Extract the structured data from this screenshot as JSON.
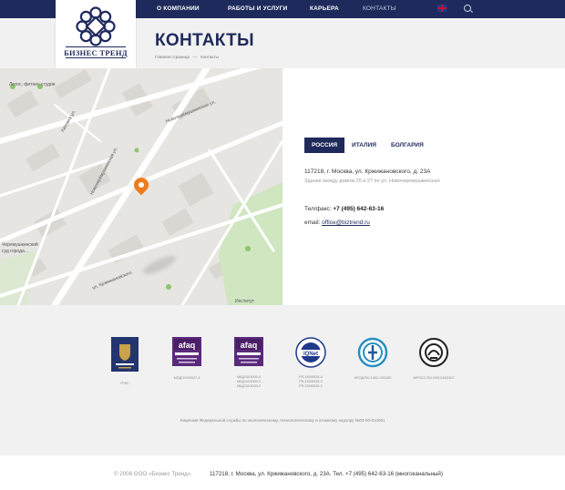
{
  "nav": {
    "items": [
      {
        "label": "О КОМПАНИИ"
      },
      {
        "label": "РАБОТЫ И УСЛУГИ"
      },
      {
        "label": "КАРЬЕРА"
      },
      {
        "label": "КОНТАКТЫ"
      }
    ]
  },
  "logo": {
    "text": "БИЗНЕС ТРЕНД"
  },
  "page": {
    "title": "КОНТАКТЫ"
  },
  "breadcrumb": {
    "home": "Главная страница",
    "separator": "—",
    "current": "Контакты"
  },
  "map": {
    "labels": [
      "Лотос, фитнес студия",
      "Каховка ул.",
      "Новочерёмушкинская ул.",
      "Новочерёмушкинская ул.",
      "Черемушкинский",
      "суд города...",
      "ул. Кржижановского",
      "Институт"
    ],
    "pin_color": "#f07b1c"
  },
  "tabs": [
    {
      "label": "РОССИЯ",
      "active": true
    },
    {
      "label": "ИТАЛИЯ",
      "active": false
    },
    {
      "label": "БОЛГАРИЯ",
      "active": false
    }
  ],
  "contact": {
    "address": "117218, г. Москва, ул. Кржижановского, д. 23А",
    "address_note": "Здание между домом 25 и 27 по ул. Новочеремушкинская",
    "phone_label": "Тел/факс:",
    "phone": "+7 (495) 642-63-16",
    "email_label": "email:",
    "email": "office@biztrend.ru"
  },
  "certs": [
    {
      "name": "GRAS",
      "lines": [
        "ГРАС"
      ]
    },
    {
      "name": "afaq ISO 9001",
      "lines": [
        "МОД/10/09027-4"
      ]
    },
    {
      "name": "afaq OHSAS",
      "lines": [
        "МКД/10/3009-4",
        "МКД/10/3009-2",
        "МКД/10/3009-2"
      ]
    },
    {
      "name": "IQNet",
      "lines": [
        "FR-15/09026-4",
        "FR-15/09026-2",
        "FR-15/09026-2"
      ]
    },
    {
      "name": "Газпром",
      "lines": [
        "МГОД.RU.1402.Х00150"
      ]
    },
    {
      "name": "Регистр",
      "lines": [
        "МРОСС.RU.НФ13.К00107"
      ]
    }
  ],
  "license": "Лицензия Федеральной службы по экологическому, технологическому и атомному надзору №03-00-014001",
  "footer": {
    "copyright": "© 2008 ООО «Бизнес Тренд».",
    "address_line": "117218, г. Москва, ул. Кржижановского, д. 23А. Тел. +7 (495) 642-63-16 (многоканальный)"
  },
  "colors": {
    "brand": "#1f2a5c",
    "accent": "#f07b1c",
    "background": "#f1f1f1"
  }
}
